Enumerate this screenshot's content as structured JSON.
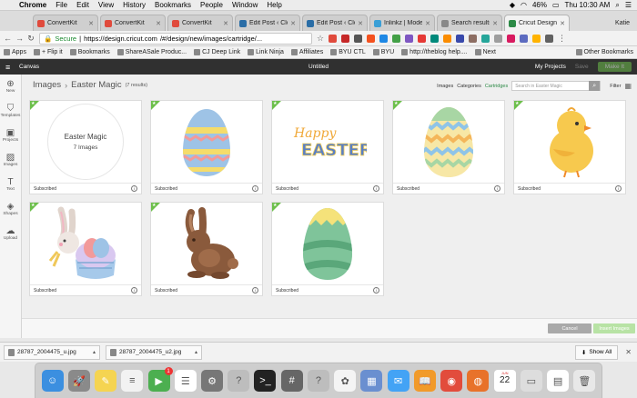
{
  "menubar": {
    "app": "Chrome",
    "items": [
      "File",
      "Edit",
      "View",
      "History",
      "Bookmarks",
      "People",
      "Window",
      "Help"
    ],
    "battery": "46%",
    "clock": "Thu 10:30 AM"
  },
  "tabs": [
    {
      "title": "ConvertKit",
      "color": "#e04a3c",
      "active": false
    },
    {
      "title": "ConvertKit",
      "color": "#e04a3c",
      "active": false
    },
    {
      "title": "ConvertKit",
      "color": "#e04a3c",
      "active": false
    },
    {
      "title": "Edit Post ‹ Clo",
      "color": "#2a6da6",
      "active": false
    },
    {
      "title": "Edit Post ‹ Clo",
      "color": "#2a6da6",
      "active": false
    },
    {
      "title": "Inlinkz | Moder",
      "color": "#3a9fd6",
      "active": false
    },
    {
      "title": "Search results",
      "color": "#888888",
      "active": false
    },
    {
      "title": "Cricut Design",
      "color": "#2c8a46",
      "active": true
    }
  ],
  "profile": "Katie",
  "address": {
    "secure_label": "Secure",
    "url_host": "https://design.cricut.com",
    "url_path": "/#/design/new/images/cartridge/..."
  },
  "bookmarks": {
    "items": [
      "Apps",
      "+ Flip it",
      "Bookmarks",
      "ShareASale Produc...",
      "CJ Deep Link",
      "Link Ninja",
      "Affiliates",
      "BYU CTL",
      "BYU",
      "http://theblog help....",
      "Next"
    ],
    "other": "Other Bookmarks"
  },
  "app": {
    "canvas_label": "Canvas",
    "doc_title": "Untitled",
    "my_projects": "My Projects",
    "save": "Save",
    "make_it": "Make It"
  },
  "sidebar": [
    {
      "label": "New",
      "icon": "plus-icon",
      "glyph": "⊕"
    },
    {
      "label": "Templates",
      "icon": "shirt-icon",
      "glyph": "⛉"
    },
    {
      "label": "Projects",
      "icon": "projects-icon",
      "glyph": "▣"
    },
    {
      "label": "Images",
      "icon": "image-icon",
      "glyph": "▨"
    },
    {
      "label": "Text",
      "icon": "text-icon",
      "glyph": "T"
    },
    {
      "label": "Shapes",
      "icon": "shapes-icon",
      "glyph": "◈"
    },
    {
      "label": "Upload",
      "icon": "cloud-upload-icon",
      "glyph": "☁"
    }
  ],
  "breadcrumb": {
    "root": "Images",
    "current": "Easter Magic",
    "results": "(7 results)"
  },
  "filters": {
    "images": "Images",
    "categories": "Categories",
    "cartridges": "Cartridges",
    "search_placeholder": "Search in Easter Magic",
    "filter": "Filter"
  },
  "set_card": {
    "title": "Easter Magic",
    "count": "7 Images"
  },
  "cards": [
    {
      "label": "Subscribed",
      "art": "easter-magic-set"
    },
    {
      "label": "Subscribed",
      "art": "striped-egg-blue"
    },
    {
      "label": "Subscribed",
      "art": "happy-easter-text"
    },
    {
      "label": "Subscribed",
      "art": "zigzag-egg"
    },
    {
      "label": "Subscribed",
      "art": "yellow-chick"
    },
    {
      "label": "Subscribed",
      "art": "bunny-basket"
    },
    {
      "label": "Subscribed",
      "art": "chocolate-bunny"
    },
    {
      "label": "Subscribed",
      "art": "green-egg"
    }
  ],
  "card_art_text": {
    "happy": "Happy",
    "easter": "EASTER"
  },
  "bottom": {
    "cancel": "Cancel",
    "insert": "Insert Images"
  },
  "downloads": [
    {
      "name": "28787_2004475_u.jpg"
    },
    {
      "name": "28787_2004475_u2.jpg"
    }
  ],
  "show_all": "Show All",
  "dock": [
    {
      "name": "finder-icon",
      "color": "#3b8fe0",
      "glyph": "☺"
    },
    {
      "name": "launchpad-icon",
      "color": "#8a8a8a",
      "glyph": "🚀"
    },
    {
      "name": "notes-icon",
      "color": "#f5d451",
      "glyph": "✎"
    },
    {
      "name": "notes-2-icon",
      "color": "#f2f2f2",
      "glyph": "≡"
    },
    {
      "name": "facetime-icon",
      "color": "#4caf50",
      "glyph": "▶",
      "badge": "1"
    },
    {
      "name": "reminders-icon",
      "color": "#ffffff",
      "glyph": "☰"
    },
    {
      "name": "system-preferences-icon",
      "color": "#777777",
      "glyph": "⚙"
    },
    {
      "name": "help-icon",
      "color": "#bdbdbd",
      "glyph": "?"
    },
    {
      "name": "terminal-icon",
      "color": "#222222",
      "glyph": ">_"
    },
    {
      "name": "calculator-icon",
      "color": "#666666",
      "glyph": "#"
    },
    {
      "name": "help-2-icon",
      "color": "#bdbdbd",
      "glyph": "?"
    },
    {
      "name": "photos-icon",
      "color": "#f4f4f4",
      "glyph": "✿"
    },
    {
      "name": "preview-icon",
      "color": "#6a8fd0",
      "glyph": "▦"
    },
    {
      "name": "messages-icon",
      "color": "#43a3f5",
      "glyph": "✉"
    },
    {
      "name": "ibooks-icon",
      "color": "#f19a2a",
      "glyph": "📖"
    },
    {
      "name": "chrome-icon",
      "color": "#e24c3c",
      "glyph": "◉"
    },
    {
      "name": "firefox-icon",
      "color": "#e8722a",
      "glyph": "◍"
    },
    {
      "name": "calendar-icon",
      "color": "#ffffff",
      "glyph": "22",
      "month": "JUN"
    },
    {
      "name": "trash-separator-icon",
      "color": "#dddddd",
      "glyph": "▭"
    },
    {
      "name": "downloads-stack-icon",
      "color": "#ffffff",
      "glyph": "▤"
    },
    {
      "name": "trash-icon",
      "color": "#e8e8e8",
      "glyph": "🗑"
    }
  ]
}
